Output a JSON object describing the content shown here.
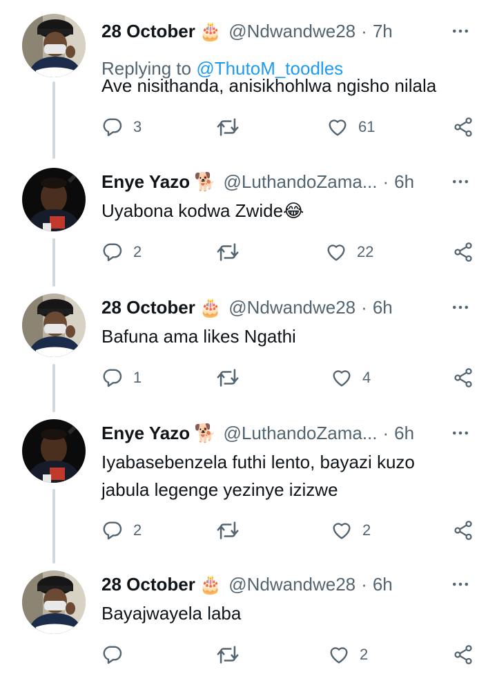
{
  "tweets": [
    {
      "name": "28 October",
      "name_emoji": "🎂",
      "handle": "@Ndwandwe28",
      "time": "7h",
      "replying_prefix": "Replying to ",
      "replying_to": "@ThutoM_toodles",
      "text": "Ave nisithanda, anisikhohlwa ngisho nilala",
      "replies": "3",
      "retweets": "",
      "likes": "61"
    },
    {
      "name": "Enye Yazo",
      "name_emoji": "🐕",
      "handle": "@LuthandoZama...",
      "time": "6h",
      "text": "Uyabona kodwa Zwide😂",
      "replies": "2",
      "retweets": "",
      "likes": "22"
    },
    {
      "name": "28 October",
      "name_emoji": "🎂",
      "handle": "@Ndwandwe28",
      "time": "6h",
      "text": "Bafuna ama likes Ngathi",
      "replies": "1",
      "retweets": "",
      "likes": "4"
    },
    {
      "name": "Enye Yazo",
      "name_emoji": "🐕",
      "handle": "@LuthandoZama...",
      "time": "6h",
      "text_line1": "Iyabasebenzela futhi lento, bayazi kuzo",
      "text_line2": "jabula legenge yezinye izizwe",
      "replies": "2",
      "retweets": "",
      "likes": "2"
    },
    {
      "name": "28 October",
      "name_emoji": "🎂",
      "handle": "@Ndwandwe28",
      "time": "6h",
      "text": "Bayajwayela laba",
      "replies": "",
      "retweets": "",
      "likes": "2"
    }
  ],
  "separator": "·",
  "icons": [
    "more-icon",
    "reply-icon",
    "retweet-icon",
    "like-icon",
    "share-icon"
  ],
  "colors": {
    "text": "#0f1419",
    "secondary": "#536471",
    "link": "#1d9bf0",
    "thread_line": "#cfd9de"
  }
}
